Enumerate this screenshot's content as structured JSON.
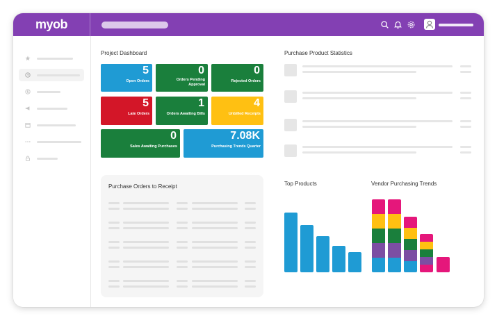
{
  "app": {
    "logo": "myob"
  },
  "header": {
    "icons": [
      "search-icon",
      "bell-icon",
      "gear-icon",
      "user-icon"
    ]
  },
  "sidebar": {
    "icons": [
      "star-icon",
      "clock-icon",
      "dollar-icon",
      "megaphone-icon",
      "calendar-icon",
      "more-icon",
      "lock-icon"
    ],
    "active_index": 1
  },
  "dashboard": {
    "title": "Project Dashboard",
    "tiles": [
      {
        "value": "5",
        "label": "Open Orders",
        "color": "#1f9bd4"
      },
      {
        "value": "0",
        "label": "Orders Pending\nApproval",
        "color": "#1a7f3c"
      },
      {
        "value": "0",
        "label": "Rejected Orders",
        "color": "#1a7f3c"
      },
      {
        "value": "5",
        "label": "Late Orders",
        "color": "#d31628"
      },
      {
        "value": "1",
        "label": "Orders Awaiting Bills",
        "color": "#1a7f3c"
      },
      {
        "value": "4",
        "label": "Unbilled Receipts",
        "color": "#ffc012"
      },
      {
        "value": "0",
        "label": "Sales Awaiting Purchases",
        "color": "#1a7f3c"
      },
      {
        "value": "7.08K",
        "label": "Purchasing Trends Quarter",
        "color": "#1f9bd4"
      }
    ]
  },
  "stats": {
    "title": "Purchase Product Statistics"
  },
  "orders": {
    "title": "Purchase  Orders to Receipt"
  },
  "top_products": {
    "title": "Top Products",
    "color": "#1f9bd4",
    "values": [
      86,
      68,
      52,
      38,
      29
    ]
  },
  "vendor_trends": {
    "title": "Vendor Purchasing Trends",
    "colors": {
      "magenta": "#e5177b",
      "yellow": "#ffc012",
      "green": "#1a7f3c",
      "purple": "#7c4ea3",
      "blue": "#1f9bd4"
    },
    "stacks": [
      [
        "blue",
        "purple",
        "green",
        "yellow",
        "magenta"
      ],
      [
        "blue",
        "purple",
        "green",
        "yellow",
        "magenta"
      ],
      [
        "blue",
        "purple",
        "green",
        "yellow",
        "magenta"
      ],
      [
        "magenta",
        "purple",
        "green",
        "yellow",
        "magenta"
      ],
      [
        "magenta"
      ]
    ]
  }
}
